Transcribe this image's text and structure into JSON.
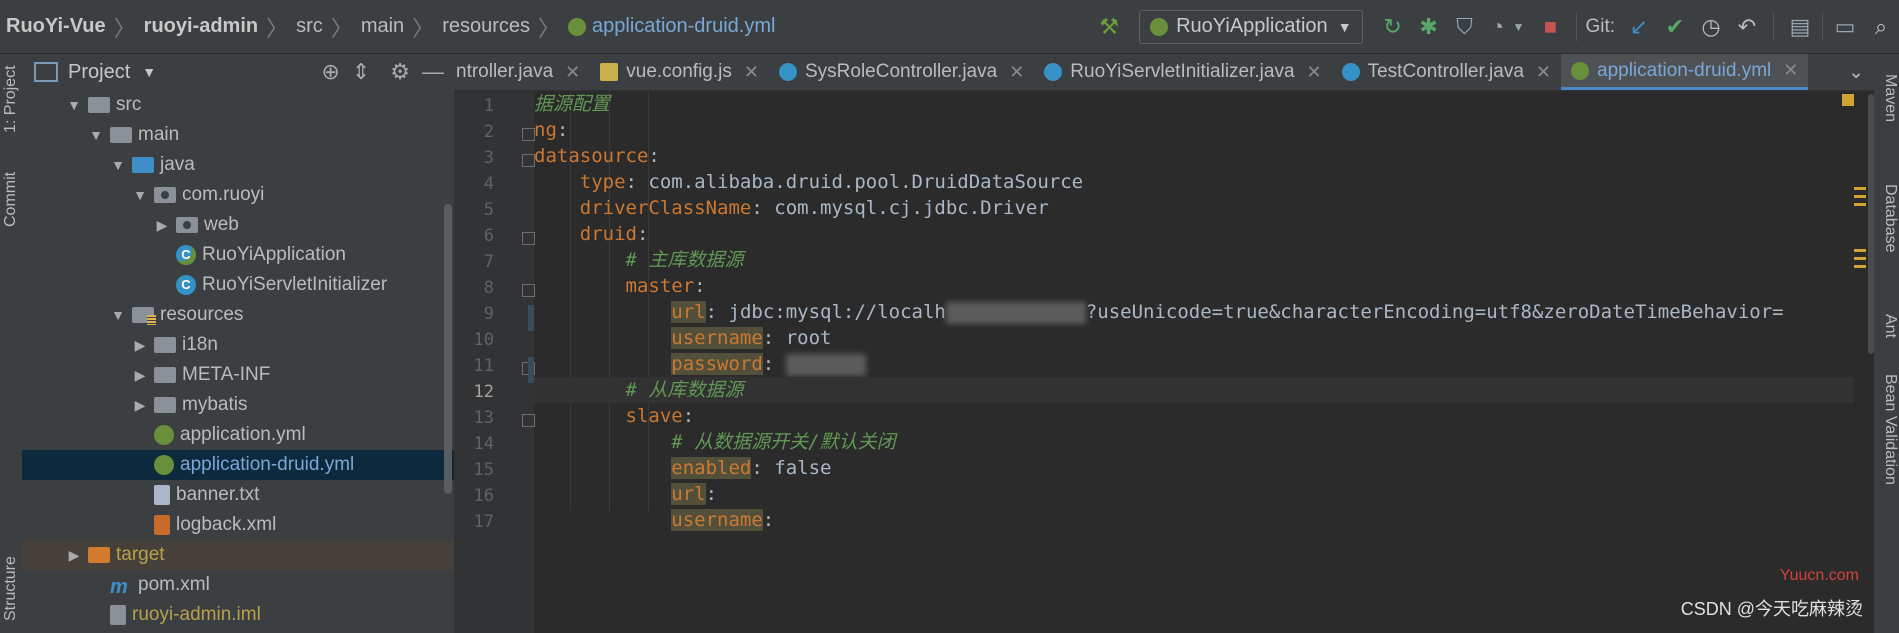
{
  "breadcrumb": {
    "items": [
      "RuoYi-Vue",
      "ruoyi-admin",
      "src",
      "main",
      "resources"
    ],
    "file": "application-druid.yml"
  },
  "toolbar": {
    "run_config": "RuoYiApplication",
    "git_label": "Git:"
  },
  "left_strip": {
    "project_tab": "1: Project",
    "commit_tab": "Commit",
    "structure_tab": "Structure"
  },
  "project_pane": {
    "title": "Project",
    "tree": [
      {
        "label": "src",
        "type": "folder"
      },
      {
        "label": "main",
        "type": "folder"
      },
      {
        "label": "java",
        "type": "source-folder"
      },
      {
        "label": "com.ruoyi",
        "type": "package"
      },
      {
        "label": "web",
        "type": "package"
      },
      {
        "label": "RuoYiApplication",
        "type": "spring-class"
      },
      {
        "label": "RuoYiServletInitializer",
        "type": "class"
      },
      {
        "label": "resources",
        "type": "resource-folder"
      },
      {
        "label": "i18n",
        "type": "folder"
      },
      {
        "label": "META-INF",
        "type": "folder"
      },
      {
        "label": "mybatis",
        "type": "folder"
      },
      {
        "label": "application.yml",
        "type": "yml"
      },
      {
        "label": "application-druid.yml",
        "type": "yml"
      },
      {
        "label": "banner.txt",
        "type": "txt"
      },
      {
        "label": "logback.xml",
        "type": "xml"
      },
      {
        "label": "target",
        "type": "excluded-folder"
      },
      {
        "label": "pom.xml",
        "type": "maven"
      },
      {
        "label": "ruoyi-admin.iml",
        "type": "iml"
      }
    ]
  },
  "tabs": [
    {
      "label": "ntroller.java"
    },
    {
      "label": "vue.config.js"
    },
    {
      "label": "SysRoleController.java"
    },
    {
      "label": "RuoYiServletInitializer.java"
    },
    {
      "label": "TestController.java"
    },
    {
      "label": "application-druid.yml"
    }
  ],
  "editor": {
    "line_numbers": [
      "1",
      "2",
      "3",
      "4",
      "5",
      "6",
      "7",
      "8",
      "9",
      "10",
      "11",
      "12",
      "13",
      "14",
      "15",
      "16",
      "17"
    ],
    "lines": {
      "l1": "据源配置",
      "l2_key": "ng",
      "l3_key": "datasource",
      "l4_key": "type",
      "l4_val": "com.alibaba.druid.pool.DruidDataSource",
      "l5_key": "driverClassName",
      "l5_val": "com.mysql.cj.jdbc.Driver",
      "l6_key": "druid",
      "l7_comment": "# 主库数据源",
      "l8_key": "master",
      "l9_key": "url",
      "l9_val_a": "jdbc:mysql://localh",
      "l9_val_b": "?useUnicode=true&characterEncoding=utf8&zeroDateTimeBehavior=",
      "l10_key": "username",
      "l10_val": "root",
      "l11_key": "password",
      "l12_comment": "# 从库数据源",
      "l13_key": "slave",
      "l14_comment": "# 从数据源开关/默认关闭",
      "l15_key": "enabled",
      "l15_val": "false",
      "l16_key": "url",
      "l17_key": "username"
    }
  },
  "right_strip": {
    "maven_tab": "Maven",
    "database_tab": "Database",
    "ant_tab": "Ant",
    "bean_tab": "Bean Validation"
  },
  "watermark": {
    "yuucn": "Yuucn.com",
    "csdn": "CSDN @今天吃麻辣烫"
  }
}
